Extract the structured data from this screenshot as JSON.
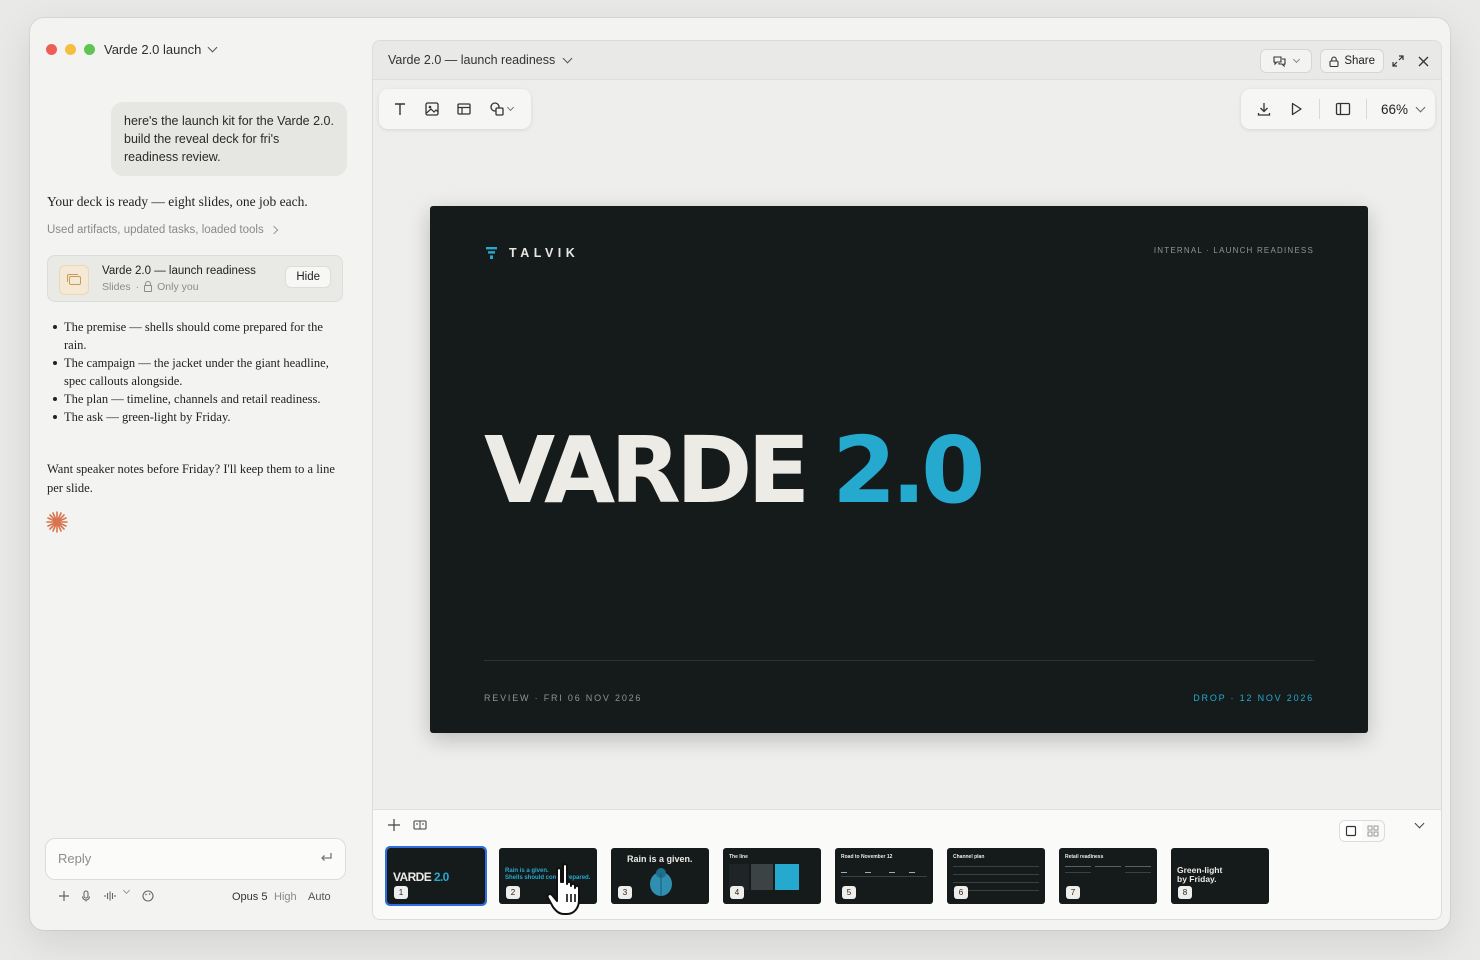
{
  "window": {
    "title": "Varde 2.0 launch"
  },
  "chat": {
    "user_message": "here's the launch kit for the Varde 2.0. build the reveal deck for fri's readiness review.",
    "assistant_intro": "Your deck is ready — eight slides, one job each.",
    "used_tools": "Used artifacts, updated tasks, loaded tools",
    "artifact": {
      "title": "Varde 2.0 — launch readiness",
      "type": "Slides",
      "visibility": "Only you",
      "hide_label": "Hide"
    },
    "bullets": [
      "The premise — shells should come prepared for the rain.",
      "The campaign — the jacket under the giant headline, spec callouts alongside.",
      "The plan — timeline, channels and retail readiness.",
      "The ask — green-light by Friday."
    ],
    "closing": "Want speaker notes before Friday? I'll keep them to a line per slide.",
    "composer": {
      "placeholder": "Reply",
      "model": "Opus 5",
      "effort": "High",
      "mode": "Auto"
    }
  },
  "doc": {
    "title": "Varde 2.0 — launch readiness",
    "share_label": "Share",
    "zoom": "66%"
  },
  "slide": {
    "brand": "TALVIK",
    "tag": "INTERNAL · LAUNCH READINESS",
    "hero_word": "VARDE",
    "hero_num": "2.0",
    "footer_left": "REVIEW · FRI 06 NOV 2026",
    "footer_right": "DROP · 12 NOV 2026",
    "accent": "#26a9cf",
    "background": "#151a1b"
  },
  "thumbnails": [
    {
      "num": "1",
      "text_a": "VARDE",
      "text_b": "2.0"
    },
    {
      "num": "2",
      "line1": "Rain is a given.",
      "line2": "Shells should come prepared."
    },
    {
      "num": "3",
      "title": "Rain is a given."
    },
    {
      "num": "4",
      "title": "The line"
    },
    {
      "num": "5",
      "title": "Road to November 12"
    },
    {
      "num": "6",
      "title": "Channel plan"
    },
    {
      "num": "7",
      "title": "Retail readiness"
    },
    {
      "num": "8",
      "line1": "Green-light",
      "line2": "by Friday."
    }
  ]
}
